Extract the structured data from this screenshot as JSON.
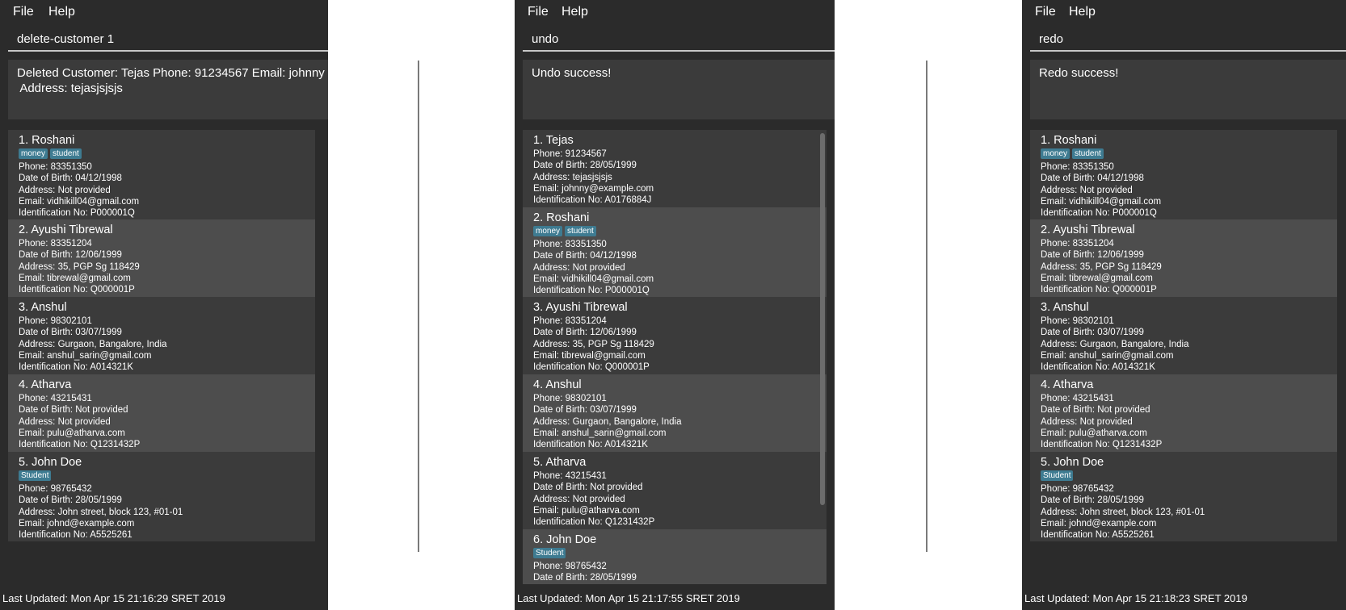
{
  "panels": [
    {
      "menu": [
        "File",
        "Help"
      ],
      "command": "delete-customer 1",
      "result": "Deleted Customer: Tejas Phone: 91234567 Email: johnny\n Address: tejasjsjsjs",
      "status": "Last Updated: Mon Apr 15 21:16:29 SRET 2019",
      "customers": [
        {
          "name": "1.  Roshani",
          "tags": [
            "money",
            "student"
          ],
          "fields": [
            "Phone: 83351350",
            "Date of Birth: 04/12/1998",
            "Address: Not provided",
            "Email: vidhikill04@gmail.com",
            "Identification No: P000001Q"
          ]
        },
        {
          "name": "2.  Ayushi Tibrewal",
          "tags": [],
          "fields": [
            "Phone: 83351204",
            "Date of Birth: 12/06/1999",
            "Address: 35, PGP Sg 118429",
            "Email: tibrewal@gmail.com",
            "Identification No: Q000001P"
          ]
        },
        {
          "name": "3.  Anshul",
          "tags": [],
          "fields": [
            "Phone: 98302101",
            "Date of Birth: 03/07/1999",
            "Address: Gurgaon, Bangalore, India",
            "Email: anshul_sarin@gmail.com",
            "Identification No: A014321K"
          ]
        },
        {
          "name": "4.  Atharva",
          "tags": [],
          "fields": [
            "Phone: 43215431",
            "Date of Birth: Not provided",
            "Address: Not provided",
            "Email: pulu@atharva.com",
            "Identification No: Q1231432P"
          ]
        },
        {
          "name": "5.  John Doe",
          "tags": [
            "Student"
          ],
          "fields": [
            "Phone: 98765432",
            "Date of Birth: 28/05/1999",
            "Address: John street, block 123, #01-01",
            "Email: johnd@example.com",
            "Identification No: A5525261"
          ]
        }
      ]
    },
    {
      "menu": [
        "File",
        "Help"
      ],
      "command": "undo",
      "result": "Undo success!",
      "status": "Last Updated: Mon Apr 15 21:17:55 SRET 2019",
      "customers": [
        {
          "name": "1.  Tejas",
          "tags": [],
          "fields": [
            "Phone: 91234567",
            "Date of Birth: 28/05/1999",
            "Address: tejasjsjsjs",
            "Email: johnny@example.com",
            "Identification No: A0176884J"
          ]
        },
        {
          "name": "2.  Roshani",
          "tags": [
            "money",
            "student"
          ],
          "fields": [
            "Phone: 83351350",
            "Date of Birth: 04/12/1998",
            "Address: Not provided",
            "Email: vidhikill04@gmail.com",
            "Identification No: P000001Q"
          ]
        },
        {
          "name": "3.  Ayushi Tibrewal",
          "tags": [],
          "fields": [
            "Phone: 83351204",
            "Date of Birth: 12/06/1999",
            "Address: 35, PGP Sg 118429",
            "Email: tibrewal@gmail.com",
            "Identification No: Q000001P"
          ]
        },
        {
          "name": "4.  Anshul",
          "tags": [],
          "fields": [
            "Phone: 98302101",
            "Date of Birth: 03/07/1999",
            "Address: Gurgaon, Bangalore, India",
            "Email: anshul_sarin@gmail.com",
            "Identification No: A014321K"
          ]
        },
        {
          "name": "5.  Atharva",
          "tags": [],
          "fields": [
            "Phone: 43215431",
            "Date of Birth: Not provided",
            "Address: Not provided",
            "Email: pulu@atharva.com",
            "Identification No: Q1231432P"
          ]
        },
        {
          "name": "6.  John Doe",
          "tags": [
            "Student"
          ],
          "fields": [
            "Phone: 98765432",
            "Date of Birth: 28/05/1999"
          ]
        }
      ]
    },
    {
      "menu": [
        "File",
        "Help"
      ],
      "command": "redo",
      "result": "Redo success!",
      "status": "Last Updated: Mon Apr 15 21:18:23 SRET 2019",
      "customers": [
        {
          "name": "1.  Roshani",
          "tags": [
            "money",
            "student"
          ],
          "fields": [
            "Phone: 83351350",
            "Date of Birth: 04/12/1998",
            "Address: Not provided",
            "Email: vidhikill04@gmail.com",
            "Identification No: P000001Q"
          ]
        },
        {
          "name": "2.  Ayushi Tibrewal",
          "tags": [],
          "fields": [
            "Phone: 83351204",
            "Date of Birth: 12/06/1999",
            "Address: 35, PGP Sg 118429",
            "Email: tibrewal@gmail.com",
            "Identification No: Q000001P"
          ]
        },
        {
          "name": "3.  Anshul",
          "tags": [],
          "fields": [
            "Phone: 98302101",
            "Date of Birth: 03/07/1999",
            "Address: Gurgaon, Bangalore, India",
            "Email: anshul_sarin@gmail.com",
            "Identification No: A014321K"
          ]
        },
        {
          "name": "4.  Atharva",
          "tags": [],
          "fields": [
            "Phone: 43215431",
            "Date of Birth: Not provided",
            "Address: Not provided",
            "Email: pulu@atharva.com",
            "Identification No: Q1231432P"
          ]
        },
        {
          "name": "5.  John Doe",
          "tags": [
            "Student"
          ],
          "fields": [
            "Phone: 98765432",
            "Date of Birth: 28/05/1999",
            "Address: John street, block 123, #01-01",
            "Email: johnd@example.com",
            "Identification No: A5525261"
          ]
        }
      ]
    }
  ]
}
